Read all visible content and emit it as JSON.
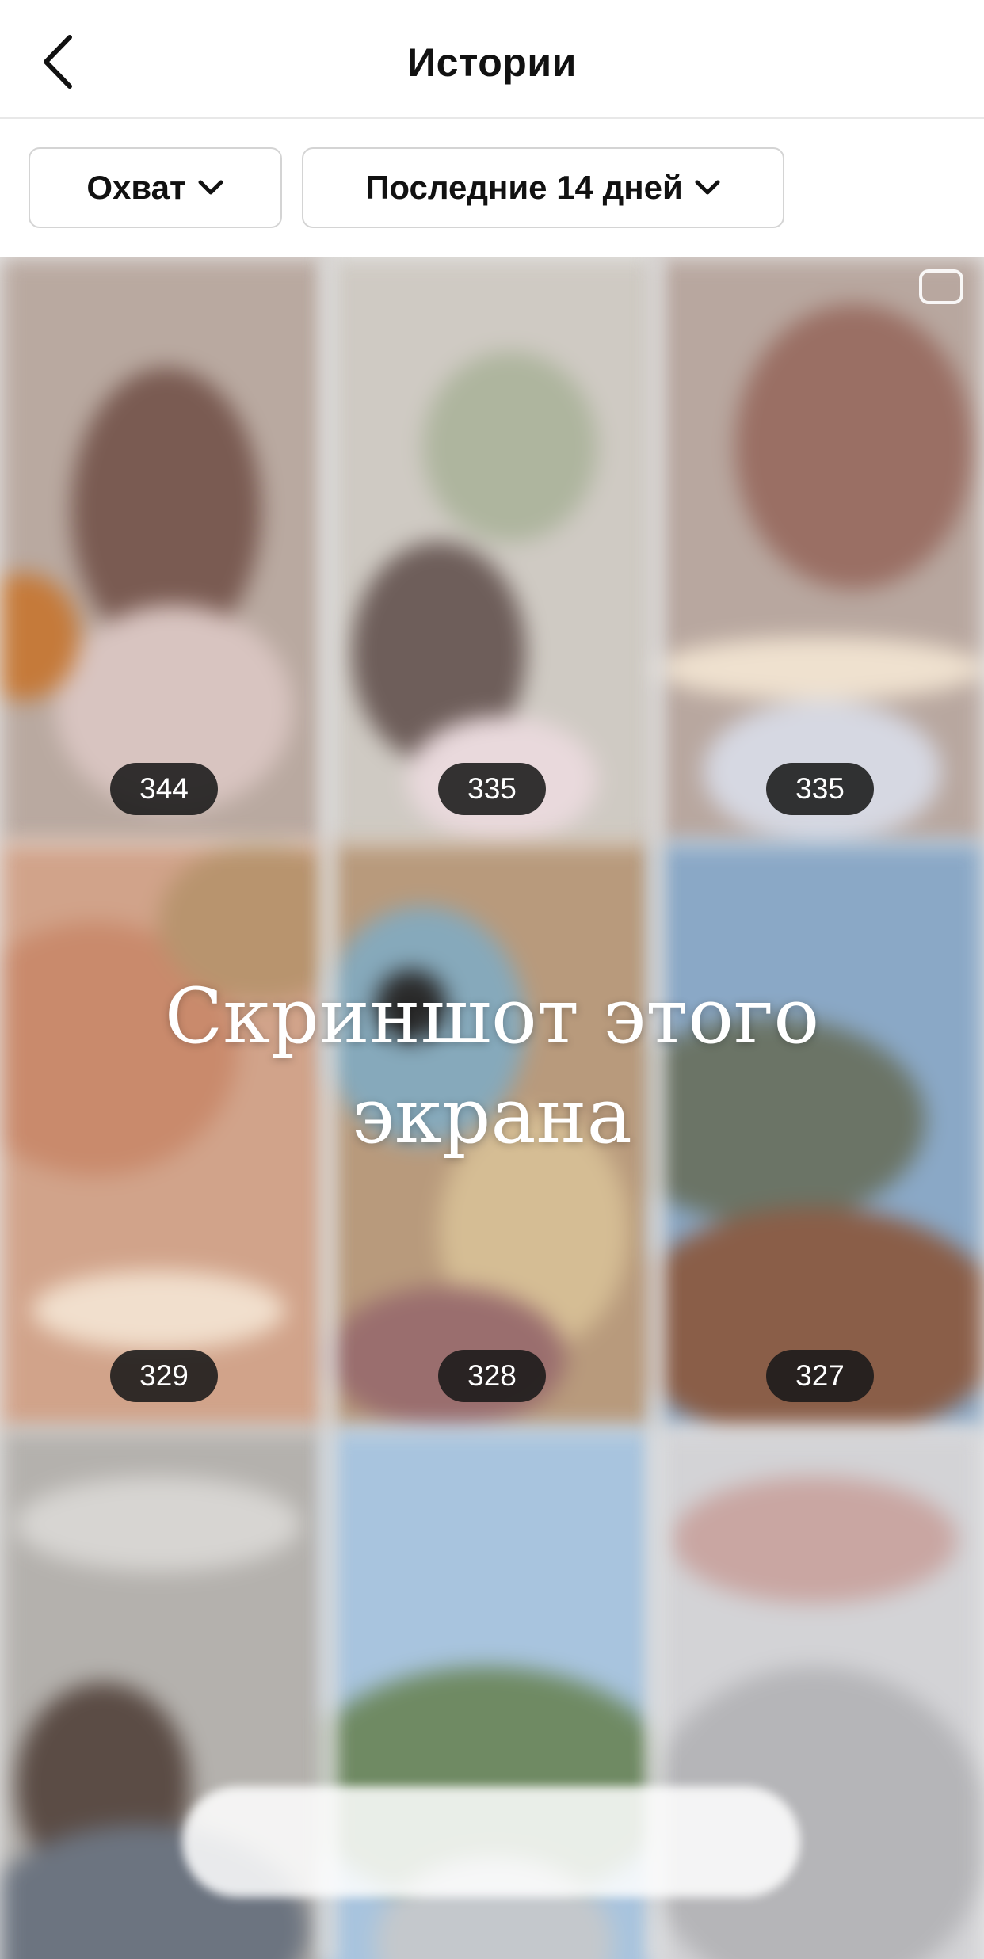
{
  "header": {
    "back_icon": "chevron-left-icon",
    "title": "Истории"
  },
  "filters": {
    "metric": {
      "label": "Охват",
      "icon": "chevron-down-icon"
    },
    "period": {
      "label": "Последние 14 дней",
      "icon": "chevron-down-icon"
    }
  },
  "stories": [
    {
      "reach": "344"
    },
    {
      "reach": "335"
    },
    {
      "reach": "335"
    },
    {
      "reach": "329"
    },
    {
      "reach": "328"
    },
    {
      "reach": "327"
    }
  ],
  "watermark": {
    "line1": "Скриншот этого",
    "line2": "экрана"
  },
  "colors": {
    "badge_bg": "#191919",
    "badge_text": "#ffffff",
    "border": "#d4d4d4"
  }
}
